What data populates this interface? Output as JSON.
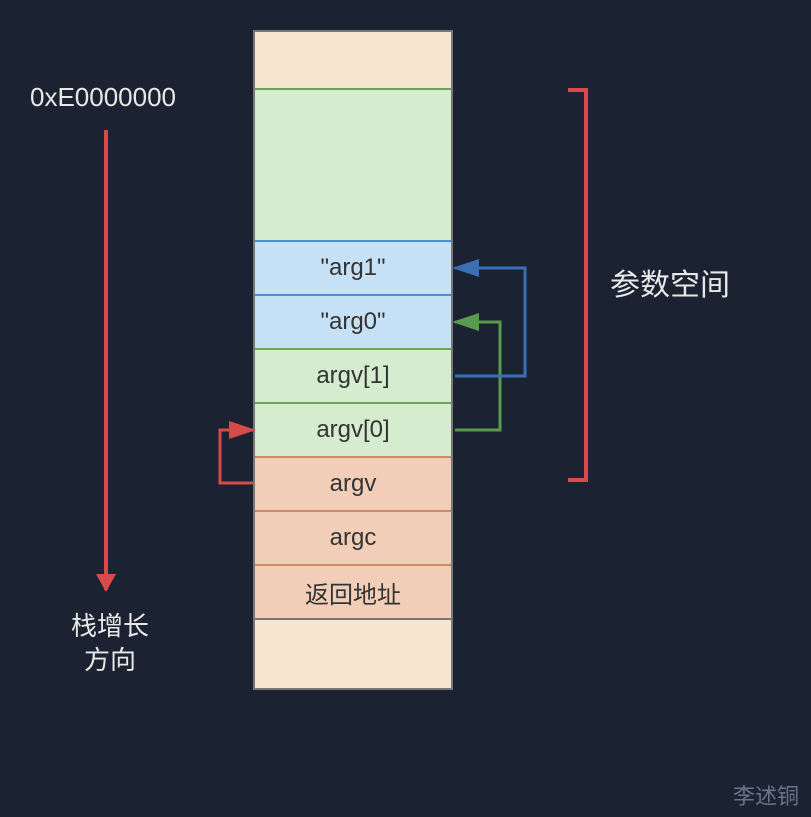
{
  "address": "0xE0000000",
  "growth": {
    "line1": "栈增长",
    "line2": "方向"
  },
  "cells": {
    "arg1_str": "\"arg1\"",
    "arg0_str": "\"arg0\"",
    "argv1": "argv[1]",
    "argv0": "argv[0]",
    "argv": "argv",
    "argc": "argc",
    "ret": "返回地址"
  },
  "right_label": "参数空间",
  "watermark": "李述铜",
  "colors": {
    "bg": "#1b2332",
    "red": "#d94a4a",
    "blue": "#3a6fb5",
    "green": "#5a9a4f"
  },
  "pointers": [
    {
      "from": "argv",
      "to": "argv[0]"
    },
    {
      "from": "argv[0]",
      "to": "\"arg0\""
    },
    {
      "from": "argv[1]",
      "to": "\"arg1\""
    }
  ]
}
